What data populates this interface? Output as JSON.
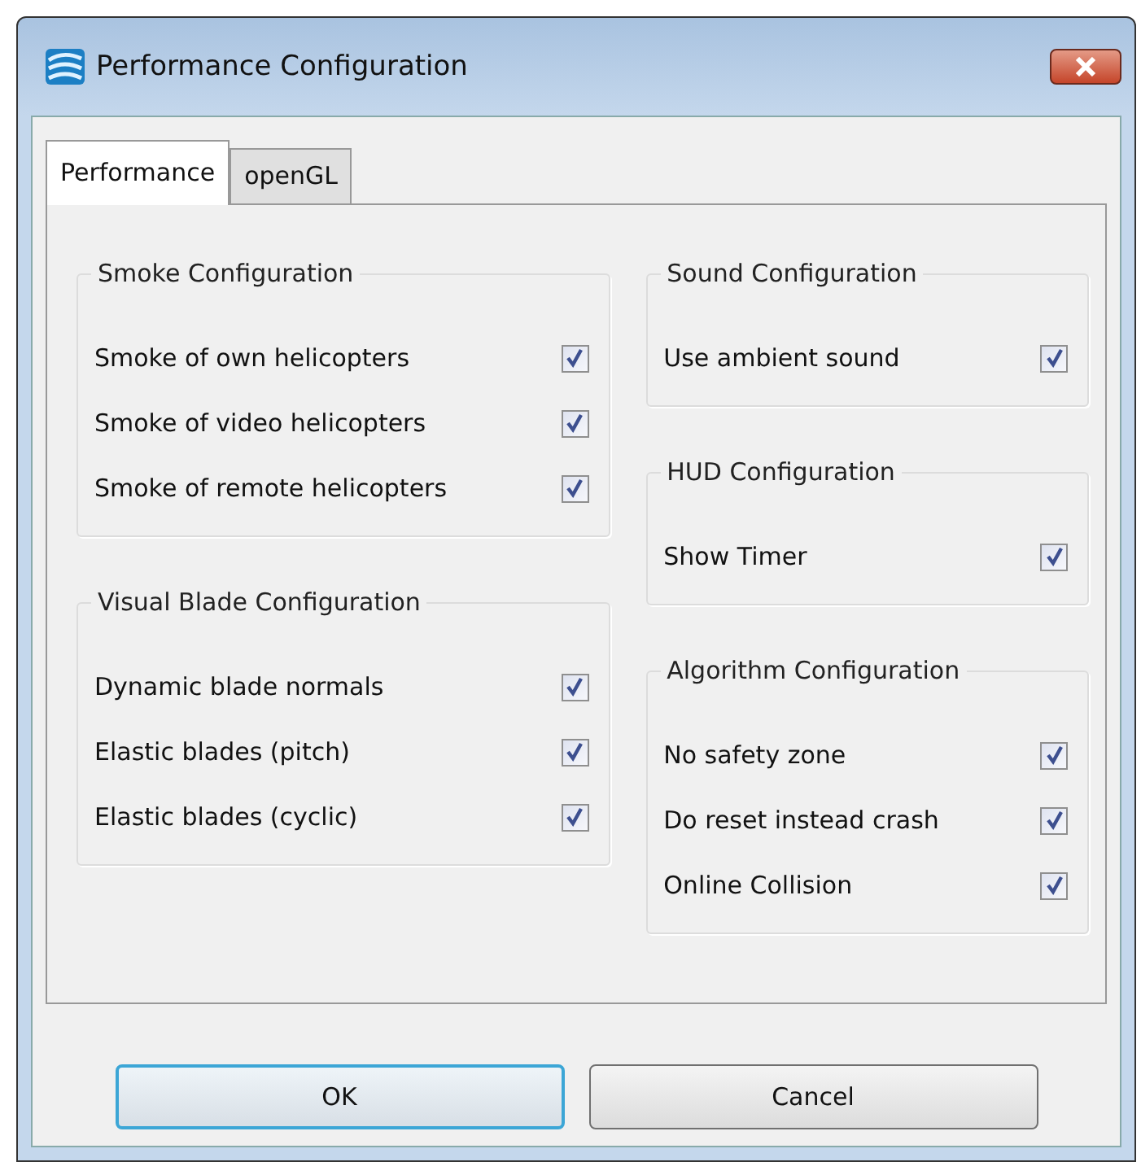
{
  "window": {
    "title": "Performance Configuration"
  },
  "tabs": [
    {
      "label": "Performance",
      "selected": true
    },
    {
      "label": "openGL",
      "selected": false
    }
  ],
  "columns": [
    {
      "groups": [
        {
          "title": "Smoke Configuration",
          "options": [
            {
              "label": "Smoke of own helicopters",
              "checked": true
            },
            {
              "label": "Smoke of video helicopters",
              "checked": true
            },
            {
              "label": "Smoke of remote helicopters",
              "checked": true
            }
          ]
        },
        {
          "title": "Visual Blade Configuration",
          "options": [
            {
              "label": "Dynamic blade normals",
              "checked": true
            },
            {
              "label": "Elastic blades (pitch)",
              "checked": true
            },
            {
              "label": "Elastic blades (cyclic)",
              "checked": true
            }
          ]
        }
      ]
    },
    {
      "groups": [
        {
          "title": "Sound Configuration",
          "options": [
            {
              "label": "Use ambient sound",
              "checked": true
            }
          ]
        },
        {
          "title": "HUD Configuration",
          "options": [
            {
              "label": "Show Timer",
              "checked": true
            }
          ]
        },
        {
          "title": "Algorithm Configuration",
          "options": [
            {
              "label": "No safety zone",
              "checked": true
            },
            {
              "label": "Do reset instead crash",
              "checked": true
            },
            {
              "label": "Online Collision",
              "checked": true
            }
          ]
        }
      ]
    }
  ],
  "buttons": [
    {
      "label": "OK",
      "default": true
    },
    {
      "label": "Cancel",
      "default": false
    }
  ]
}
